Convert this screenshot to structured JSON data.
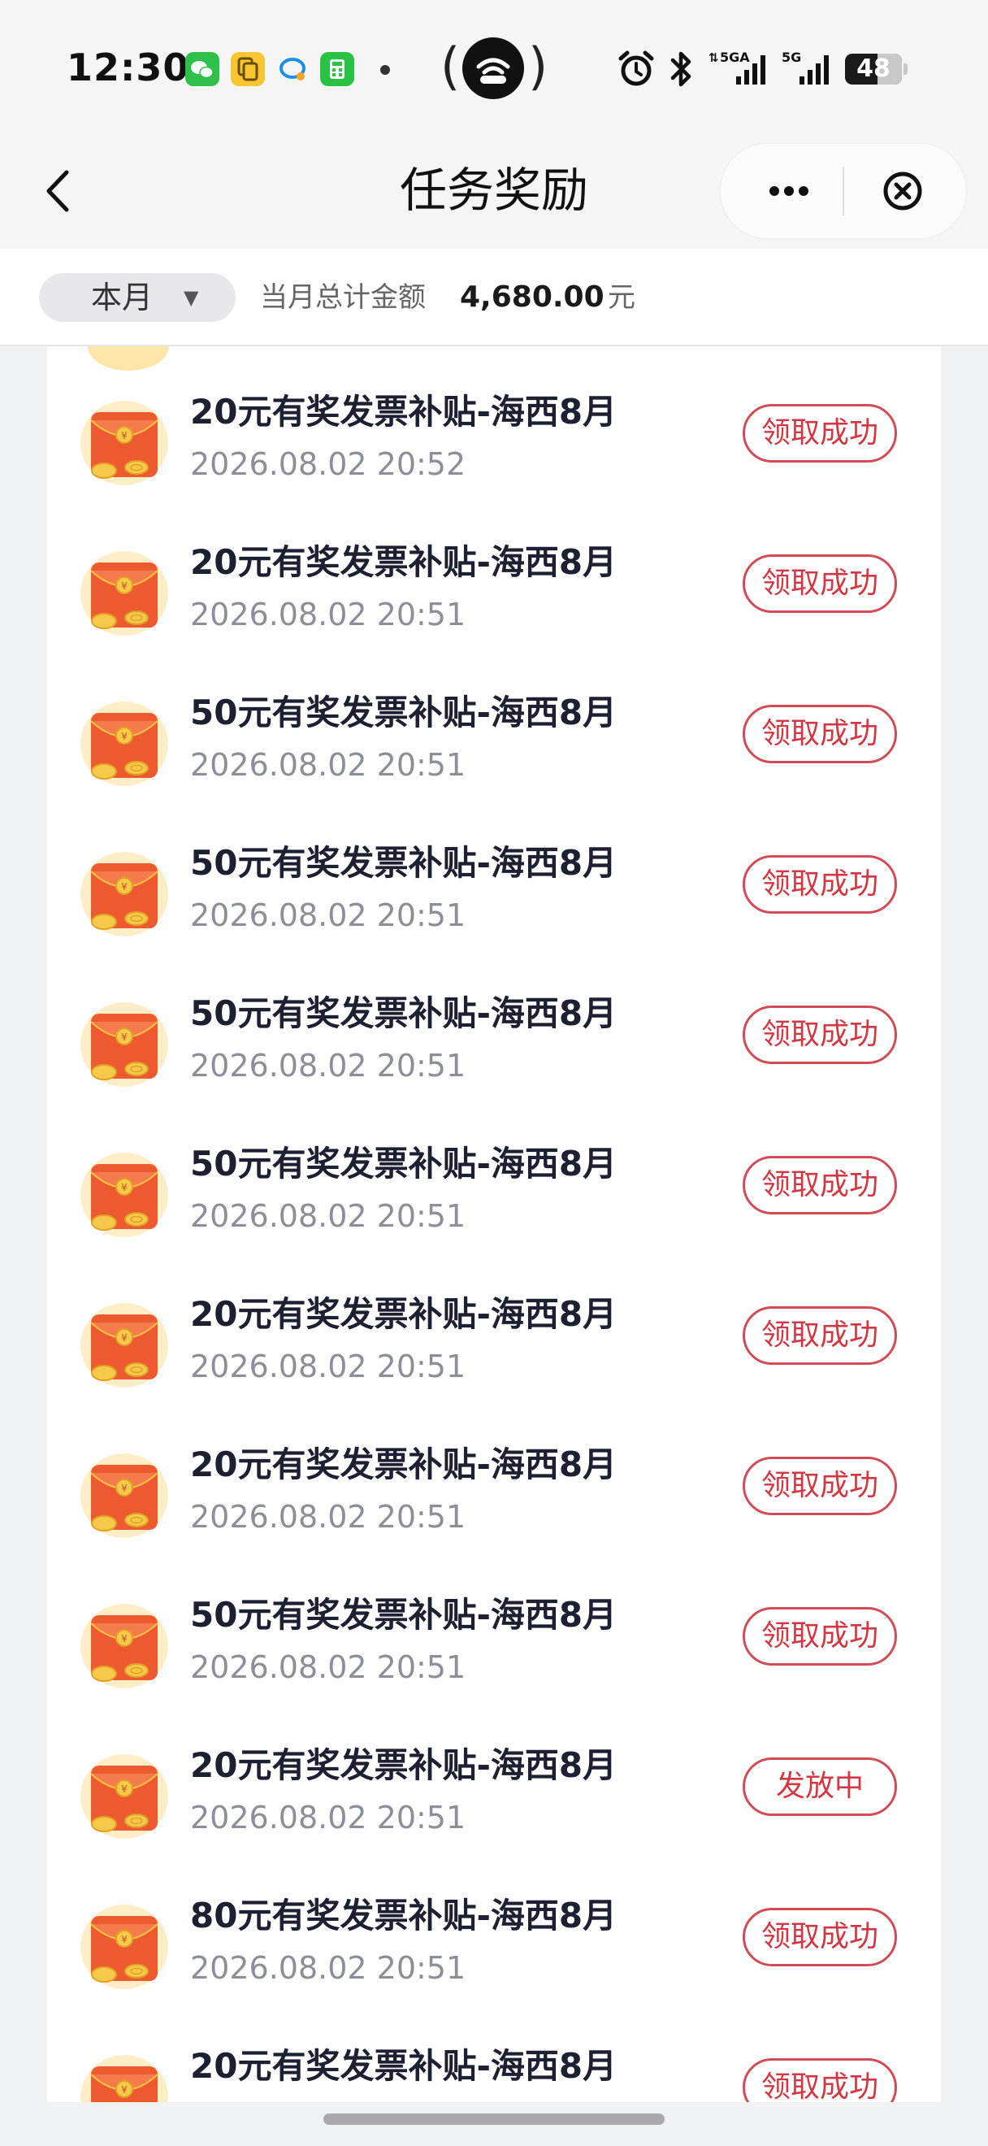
{
  "status_bar": {
    "time": "12:30",
    "apps": [
      "wechat-icon",
      "copy-app-icon",
      "chat-app-icon",
      "calculator-app-icon"
    ],
    "indicators": [
      "alarm-icon",
      "bluetooth-icon",
      "5g-signal-icon",
      "5g-signal-icon"
    ],
    "network_labels": [
      "5GA",
      "5G"
    ],
    "battery": "48"
  },
  "nav": {
    "title": "任务奖励"
  },
  "filter": {
    "month": "本月",
    "total_label": "当月总计金额",
    "total_amount": "4,680.00",
    "total_unit": "元"
  },
  "colors": {
    "accent_red": "#d23744",
    "envelope_red": "#ee5a2f",
    "coin_gold": "#f6c244"
  },
  "rewards": [
    {
      "title": "20元有奖发票补贴-海西8月",
      "time": "2026.08.02 20:52",
      "status": "领取成功"
    },
    {
      "title": "20元有奖发票补贴-海西8月",
      "time": "2026.08.02 20:51",
      "status": "领取成功"
    },
    {
      "title": "50元有奖发票补贴-海西8月",
      "time": "2026.08.02 20:51",
      "status": "领取成功"
    },
    {
      "title": "50元有奖发票补贴-海西8月",
      "time": "2026.08.02 20:51",
      "status": "领取成功"
    },
    {
      "title": "50元有奖发票补贴-海西8月",
      "time": "2026.08.02 20:51",
      "status": "领取成功"
    },
    {
      "title": "50元有奖发票补贴-海西8月",
      "time": "2026.08.02 20:51",
      "status": "领取成功"
    },
    {
      "title": "20元有奖发票补贴-海西8月",
      "time": "2026.08.02 20:51",
      "status": "领取成功"
    },
    {
      "title": "20元有奖发票补贴-海西8月",
      "time": "2026.08.02 20:51",
      "status": "领取成功"
    },
    {
      "title": "50元有奖发票补贴-海西8月",
      "time": "2026.08.02 20:51",
      "status": "领取成功"
    },
    {
      "title": "20元有奖发票补贴-海西8月",
      "time": "2026.08.02 20:51",
      "status": "发放中"
    },
    {
      "title": "80元有奖发票补贴-海西8月",
      "time": "2026.08.02 20:51",
      "status": "领取成功"
    },
    {
      "title": "20元有奖发票补贴-海西8月",
      "time": "",
      "status": "领取成功"
    }
  ]
}
